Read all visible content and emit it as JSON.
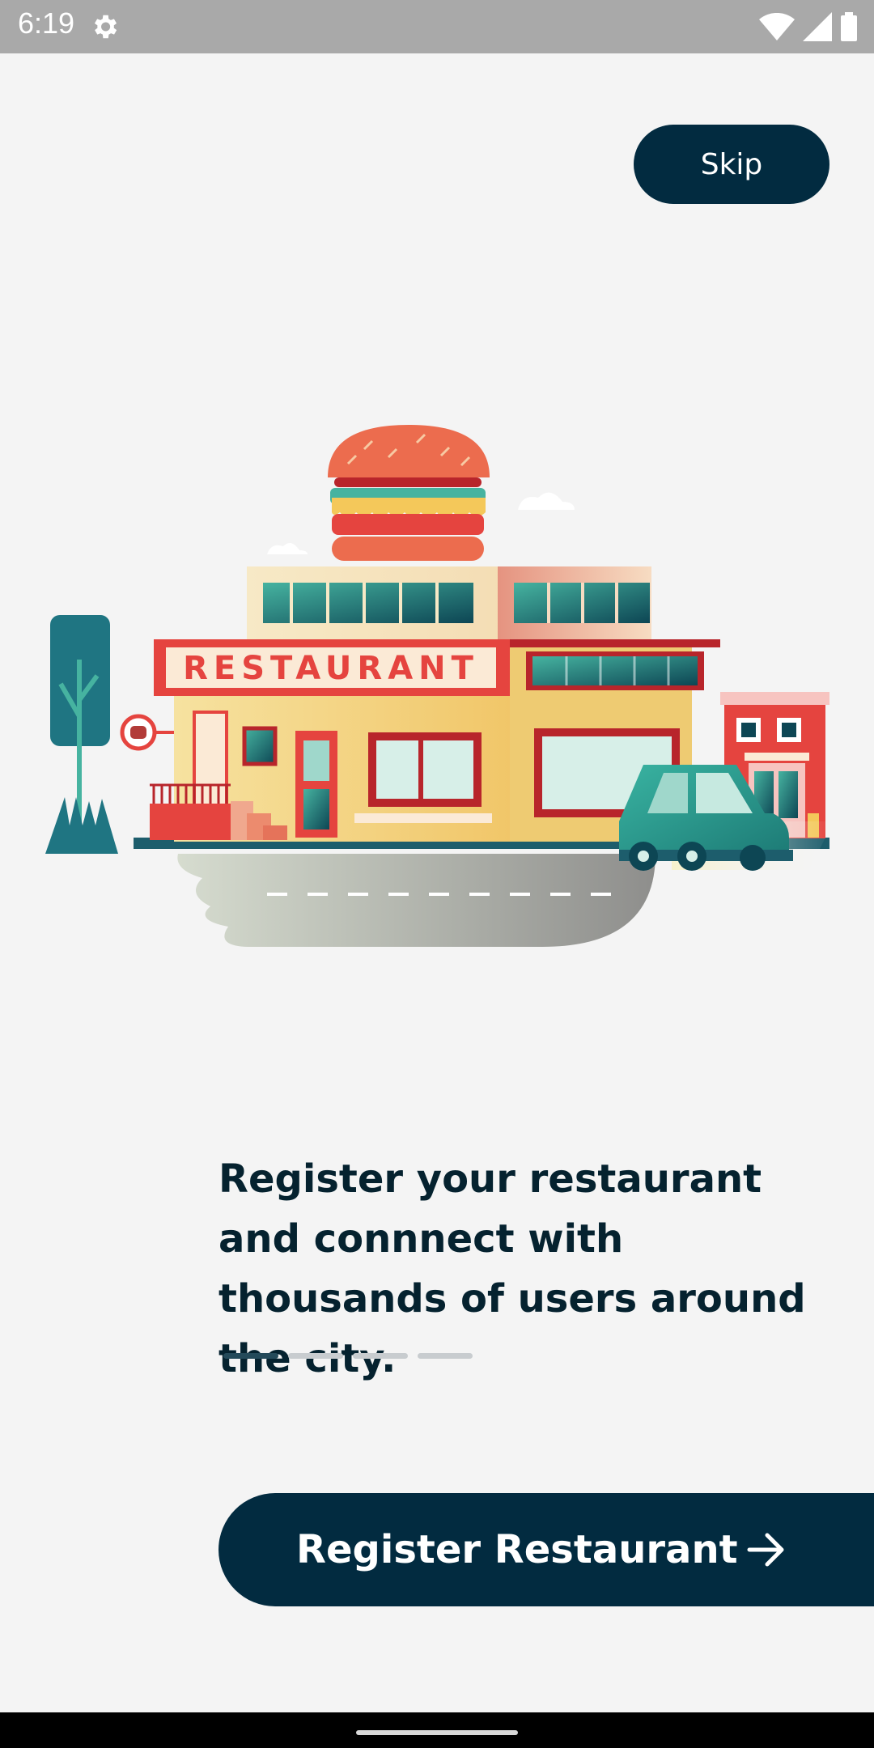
{
  "status_bar": {
    "time": "6:19",
    "icons": [
      "settings-icon",
      "wifi-icon",
      "cell-signal-icon",
      "battery-icon"
    ]
  },
  "onboarding": {
    "skip_label": "Skip",
    "illustration_sign_text": "RESTAURANT",
    "headline": "Register your restaurant and connnect with thousands of users around the city.",
    "pager": {
      "total": 4,
      "active_index": 0
    },
    "register_label": "Register Restaurant"
  },
  "colors": {
    "primary_dark": "#022b40",
    "background": "#f4f4f4",
    "dot_active": "#244a5a",
    "dot_inactive": "#c8cccf"
  }
}
